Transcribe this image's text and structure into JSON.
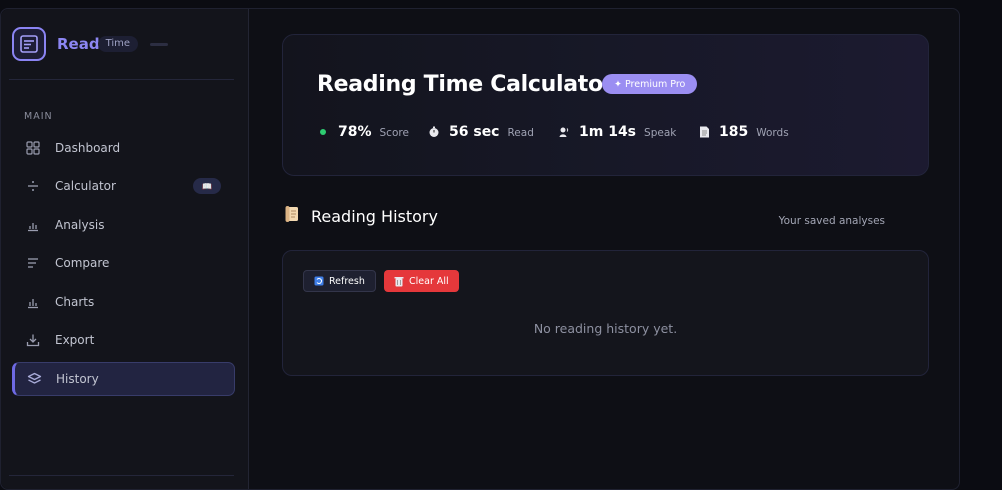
{
  "brand": {
    "name": "Read",
    "tag": "Time"
  },
  "sidebar": {
    "section_label": "MAIN",
    "items": [
      {
        "label": "Dashboard",
        "icon": "grid-icon",
        "active": false
      },
      {
        "label": "Calculator",
        "icon": "calculator-icon",
        "active": false,
        "badge": "📖"
      },
      {
        "label": "Analysis",
        "icon": "bar-chart-icon",
        "active": false
      },
      {
        "label": "Compare",
        "icon": "list-lines-icon",
        "active": false
      },
      {
        "label": "Charts",
        "icon": "chart-icon",
        "active": false
      },
      {
        "label": "Export",
        "icon": "download-icon",
        "active": false
      },
      {
        "label": "History",
        "icon": "layers-icon",
        "active": true
      }
    ]
  },
  "hero": {
    "title": "Reading Time Calculator",
    "badge": "✦ Premium Pro",
    "stats": [
      {
        "icon": "green-dot-icon",
        "value": "78%",
        "label": "Score"
      },
      {
        "icon": "stopwatch-icon",
        "value": "56 sec",
        "label": "Read"
      },
      {
        "icon": "speaking-icon",
        "value": "1m 14s",
        "label": "Speak"
      },
      {
        "icon": "document-icon",
        "value": "185",
        "label": "Words"
      }
    ]
  },
  "history": {
    "title": "Reading History",
    "subtitle": "Your saved analyses",
    "refresh_label": "Refresh",
    "clear_label": "Clear All",
    "empty_text": "No reading history yet."
  },
  "colors": {
    "accent": "#8b84f3",
    "premium": "#9b8ef2",
    "danger": "#e5383b",
    "score_dot": "#2ecc71"
  }
}
